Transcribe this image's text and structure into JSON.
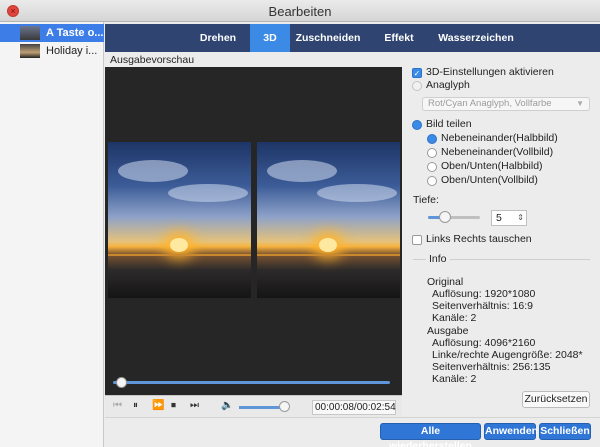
{
  "window": {
    "title": "Bearbeiten",
    "close_glyph": "×"
  },
  "sidebar": {
    "items": [
      {
        "label": "A Taste o...",
        "selected": true
      },
      {
        "label": "Holiday i...",
        "selected": false
      }
    ]
  },
  "tabs": [
    {
      "label": "Drehen",
      "active": false
    },
    {
      "label": "3D",
      "active": true
    },
    {
      "label": "Zuschneiden",
      "active": false
    },
    {
      "label": "Effekt",
      "active": false
    },
    {
      "label": "Wasserzeichen",
      "active": false
    }
  ],
  "preview": {
    "label": "Ausgabevorschau"
  },
  "playback": {
    "time": "00:00:08/00:02:54",
    "progress_fraction": 0.03,
    "volume_fraction": 0.9,
    "icons": [
      "skip-back-icon",
      "pause-icon",
      "fast-forward-icon",
      "stop-icon",
      "skip-forward-icon",
      "speaker-icon"
    ]
  },
  "settings": {
    "enable_3d": {
      "label": "3D-Einstellungen aktivieren",
      "checked": true
    },
    "anaglyph": {
      "label": "Anaglyph",
      "selected": false
    },
    "anaglyph_select": {
      "value": "Rot/Cyan Anaglyph, Vollfarbe"
    },
    "split": {
      "label": "Bild teilen",
      "selected": true
    },
    "split_options": [
      {
        "label": "Nebeneinander(Halbbild)",
        "selected": true
      },
      {
        "label": "Nebeneinander(Vollbild)",
        "selected": false
      },
      {
        "label": "Oben/Unten(Halbbild)",
        "selected": false
      },
      {
        "label": "Oben/Unten(Vollbild)",
        "selected": false
      }
    ],
    "depth": {
      "label": "Tiefe:",
      "value": "5"
    },
    "swap": {
      "label": "Links Rechts tauschen",
      "checked": false
    }
  },
  "info": {
    "title": "Info",
    "original": {
      "heading": "Original",
      "resolution": "Auflösung: 1920*1080",
      "aspect": "Seitenverhältnis: 16:9",
      "channels": "Kanäle: 2"
    },
    "output": {
      "heading": "Ausgabe",
      "resolution": "Auflösung: 4096*2160",
      "eye_size": "Linke/rechte Augengröße: 2048*",
      "aspect": "Seitenverhältnis: 256:135",
      "channels": "Kanäle: 2"
    }
  },
  "buttons": {
    "reset": "Zurücksetzen",
    "restore_all": "Alle wiederherstellen",
    "apply": "Anwenden",
    "close": "Schließen"
  },
  "colors": {
    "accent": "#3b8be6",
    "tabbar": "#2f4470",
    "preview_bg": "#262626"
  }
}
